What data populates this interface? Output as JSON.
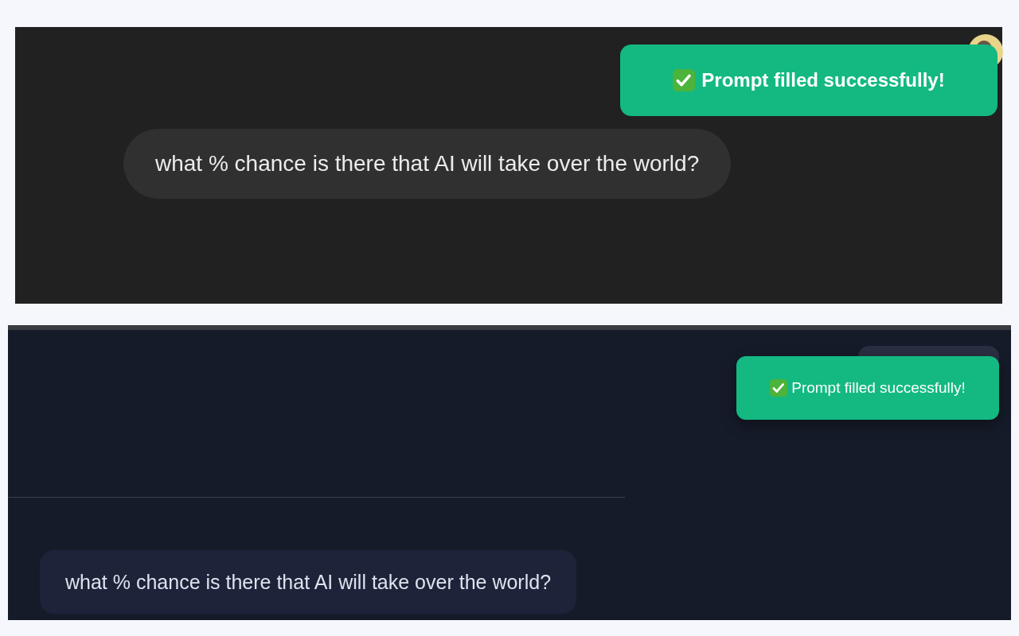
{
  "panels": [
    {
      "kind": "dark",
      "toast": {
        "text": "Prompt filled successfully!"
      },
      "message": {
        "text": "what % chance is there that AI will take over the world?"
      }
    },
    {
      "kind": "navy",
      "toast": {
        "text": "Prompt filled successfully!"
      },
      "message": {
        "text": "what % chance is there that AI will take over the world?"
      }
    }
  ]
}
